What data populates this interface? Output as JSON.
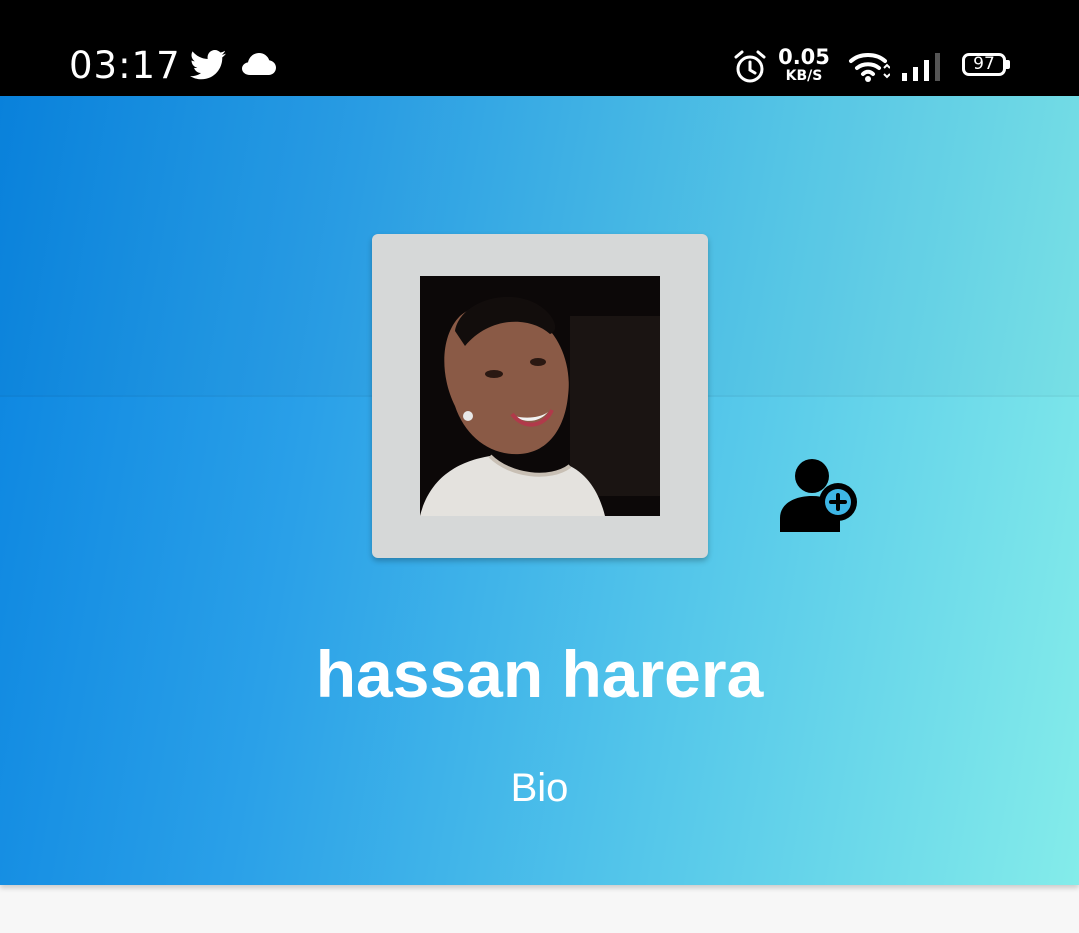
{
  "status_bar": {
    "time": "03:17",
    "net_speed_value": "0.05",
    "net_speed_unit": "KB/S",
    "battery_level": "97",
    "icons": [
      "twitter-icon",
      "cloud-icon",
      "alarm-icon",
      "wifi-icon",
      "signal-icon",
      "battery-icon"
    ]
  },
  "profile": {
    "name": "hassan harera",
    "bio": "Bio",
    "actions": [
      "add-friend-icon"
    ]
  },
  "colors": {
    "gradient_start": "#0a84e0",
    "gradient_end": "#84ecea",
    "avatar_frame": "#d6d8d8",
    "status_bar_bg": "#000000"
  }
}
